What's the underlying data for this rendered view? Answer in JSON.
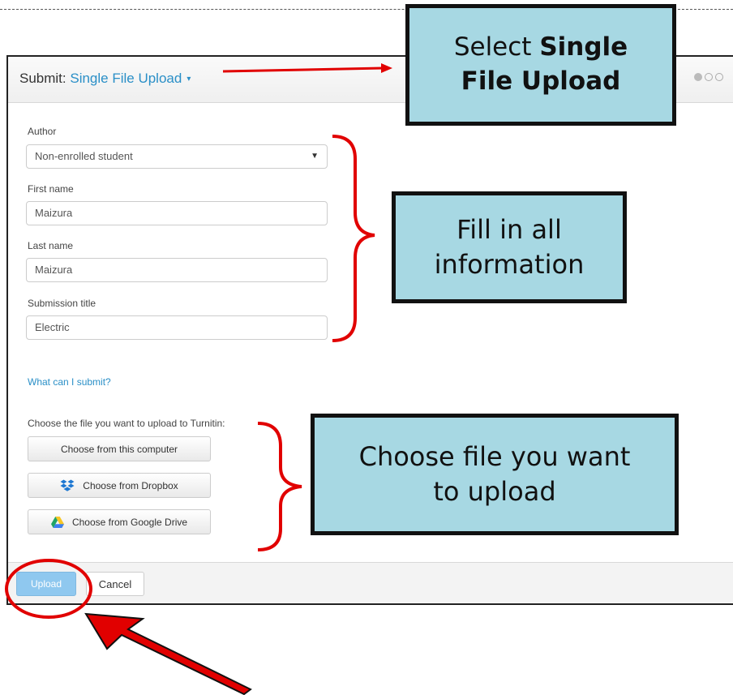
{
  "header": {
    "prefix": "Submit: ",
    "mode": "Single File Upload",
    "caret": "▾"
  },
  "form": {
    "author_label": "Author",
    "author_value": "Non-enrolled student",
    "first_name_label": "First name",
    "first_name_value": "Maizura",
    "last_name_label": "Last name",
    "last_name_value": "Maizura",
    "title_label": "Submission title",
    "title_value": "Electric",
    "help_link": "What can I submit?",
    "choose_label": "Choose the file you want to upload to Turnitin:"
  },
  "file_sources": {
    "computer": "Choose from this computer",
    "dropbox": "Choose from Dropbox",
    "gdrive": "Choose from Google Drive"
  },
  "footer": {
    "upload": "Upload",
    "cancel": "Cancel"
  },
  "callouts": {
    "select_pre": "Select ",
    "select_bold1": "Single",
    "select_bold2": "File Upload",
    "fill_line1": "Fill in all",
    "fill_line2": "information",
    "choose_line1": "Choose file you want",
    "choose_line2": "to upload"
  },
  "colors": {
    "callout_bg": "#a7d8e3",
    "annotation_red": "#e10000",
    "link_blue": "#2a8fc7"
  },
  "icons": [
    "caret-down-icon",
    "dropbox-icon",
    "google-drive-icon",
    "progress-dots-icon"
  ]
}
